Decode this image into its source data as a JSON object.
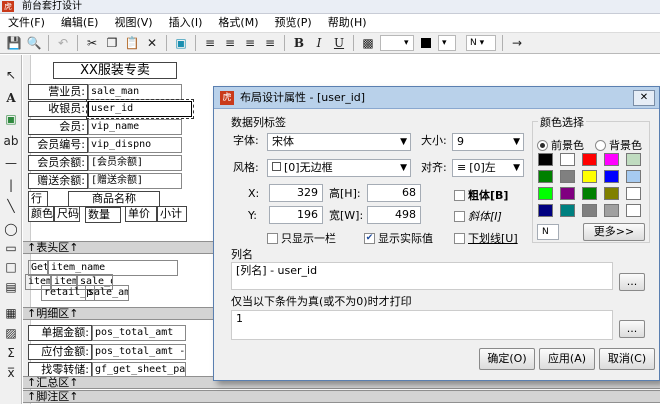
{
  "window": {
    "title": "前台套打设计",
    "logo": "虎"
  },
  "menu": [
    "文件(F)",
    "编辑(E)",
    "视图(V)",
    "插入(I)",
    "格式(M)",
    "预览(P)",
    "帮助(H)"
  ],
  "toolbar": {
    "fill_icon": "fill-color-icon",
    "font_color_icon": "font-color-icon",
    "size_dropdown": "N"
  },
  "design": {
    "title": "XX服装专卖",
    "rows": [
      {
        "label": "营业员:",
        "field": "sale_man"
      },
      {
        "label": "收银员:",
        "field": "user_id"
      },
      {
        "label": "会员:",
        "field": "vip_name"
      },
      {
        "label": "会员编号:",
        "field": "vip_dispno"
      },
      {
        "label": "会员余额:",
        "field": "[会员余额]"
      },
      {
        "label": "赠送余额:",
        "field": "[赠送余额]"
      }
    ],
    "table_head": {
      "c1": "行",
      "c2": "商品名称",
      "c3": "颜色",
      "c4": "尺码",
      "c5": "数量",
      "c6": "单价",
      "c7": "小计"
    },
    "header_section": "表头区",
    "detail": {
      "get_label": "Get",
      "item_name": "item_name",
      "item_a": "item",
      "item_b": "item",
      "sale_q": "sale_q",
      "retail": "retail_pri",
      "sale_amt": "sale_amt"
    },
    "detail_section": "明细区",
    "totals": [
      {
        "label": "单据金额:",
        "field": "pos_total_amt"
      },
      {
        "label": "应付金额:",
        "field": "pos_total_amt -"
      },
      {
        "label": "找零转储:",
        "field": "gf_get_sheet_pay"
      }
    ],
    "summary_section": "汇总区",
    "footer_section": "脚注区"
  },
  "dialog": {
    "title": "布局设计属性 - [user_id]",
    "logo": "虎",
    "data_label_group": "数据列标签",
    "font_label": "字体:",
    "font_value": "宋体",
    "size_label": "大小:",
    "size_value": "9",
    "style_label": "风格:",
    "style_value": "[0]无边框",
    "align_label": "对齐:",
    "align_value": "[0]左",
    "x_label": "X:",
    "x_value": "329",
    "h_label": "高[H]:",
    "h_value": "68",
    "y_label": "Y:",
    "y_value": "196",
    "w_label": "宽[W]:",
    "w_value": "498",
    "bold": "粗体[B]",
    "italic": "斜体[I]",
    "underline": "下划线[U]",
    "only_one_column": "只显示一栏",
    "show_actual": "显示实际值",
    "color_group": "颜色选择",
    "fg": "前景色",
    "bg": "背景色",
    "more": "更多>>",
    "color_indicator": "N",
    "column_label": "列名",
    "column_value": "[列名] - user_id",
    "condition_label": "仅当以下条件为真(或不为0)时才打印",
    "condition_value": "1",
    "browse": "...",
    "ok": "确定(O)",
    "apply": "应用(A)",
    "cancel": "取消(C)",
    "palette": [
      "#000000",
      "#ffffff",
      "#ff0000",
      "#ff00ff",
      "#c0dcc0",
      "#008000",
      "#808080",
      "#ffff00",
      "#0000ff",
      "#a6caf0",
      "#00ff00",
      "#800080",
      "#008000",
      "#808000",
      "#ffffff",
      "#000080",
      "#008080",
      "#808080",
      "#a0a0a0",
      "#ffffff"
    ]
  }
}
